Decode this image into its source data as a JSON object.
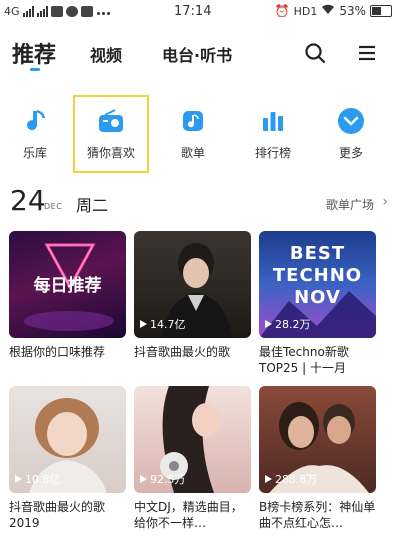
{
  "status_bar": {
    "left_text": "4G",
    "time": "17:14",
    "hd_label": "HD1",
    "battery": "53%"
  },
  "header": {
    "tabs": [
      "推荐",
      "视频",
      "电台·听书"
    ],
    "active_tab": 0,
    "accent": "#2a9bf0"
  },
  "categories": [
    {
      "label": "乐库",
      "icon": "music-note-icon"
    },
    {
      "label": "猜你喜欢",
      "icon": "radio-icon"
    },
    {
      "label": "歌单",
      "icon": "playlist-icon"
    },
    {
      "label": "排行榜",
      "icon": "bar-chart-icon"
    },
    {
      "label": "更多",
      "icon": "chevron-down-icon"
    }
  ],
  "date": {
    "day": "24",
    "month": "DEC",
    "weekday": "周二",
    "plaza_link": "歌单广场"
  },
  "cards": [
    {
      "caption": "根据你的口味推荐",
      "plays": "",
      "cover_text": "每日推荐"
    },
    {
      "caption": "抖音歌曲最火的歌",
      "plays": "14.7亿",
      "cover_text": ""
    },
    {
      "caption": "最佳Techno新歌TOP25 | 十一月",
      "plays": "28.2万",
      "cover_text": "BEST TECHNO NOV"
    },
    {
      "caption": "抖音歌曲最火的歌2019",
      "plays": "10.8亿",
      "cover_text": ""
    },
    {
      "caption": "中文DJ，精选曲目，给你不一样…",
      "plays": "92.5万",
      "cover_text": ""
    },
    {
      "caption": "B榜卡榜系列：神仙单曲不点红心怎…",
      "plays": "288.8万",
      "cover_text": ""
    }
  ]
}
